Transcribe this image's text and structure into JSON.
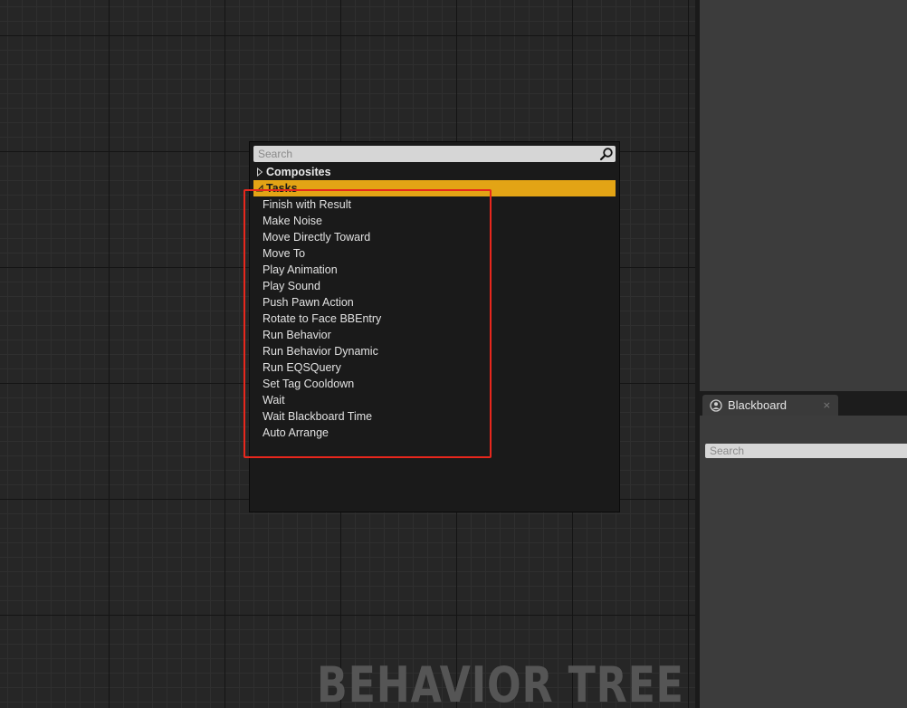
{
  "graph": {
    "watermark": "BEHAVIOR TREE"
  },
  "context_menu": {
    "search": {
      "placeholder": "Search",
      "value": ""
    },
    "categories": [
      {
        "label": "Composites",
        "expanded": false
      },
      {
        "label": "Tasks",
        "expanded": true,
        "selected": true
      }
    ],
    "task_items": [
      "Finish with Result",
      "Make Noise",
      "Move Directly Toward",
      "Move To",
      "Play Animation",
      "Play Sound",
      "Push Pawn Action",
      "Rotate to Face BBEntry",
      "Run Behavior",
      "Run Behavior Dynamic",
      "Run EQSQuery",
      "Set Tag Cooldown",
      "Wait",
      "Wait Blackboard Time",
      "Auto Arrange"
    ]
  },
  "blackboard_panel": {
    "tab_label": "Blackboard",
    "tab_icon": "blackboard-icon",
    "close_glyph": "×",
    "search": {
      "placeholder": "Search",
      "value": ""
    }
  },
  "colors": {
    "selected_category": "#e3a415",
    "annotation_box": "#e8271d",
    "menu_background": "#1a1a1a",
    "panel_background": "#3c3c3c"
  }
}
